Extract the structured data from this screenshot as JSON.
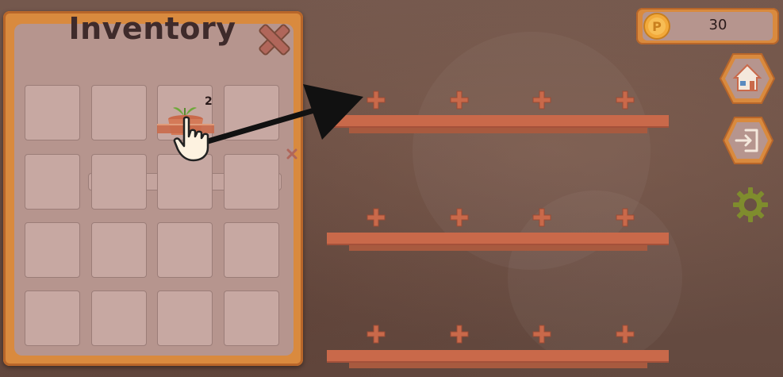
{
  "inventory": {
    "title": "Inventory",
    "item_count": "2"
  },
  "currency": {
    "value": "30",
    "symbol": "P"
  },
  "icons": {
    "close": "close-icon",
    "home": "home-icon",
    "exit": "exit-icon",
    "settings": "gear-icon",
    "hand": "hand-pointer-icon",
    "pot": "plant-pot-icon",
    "coin": "coin-icon"
  },
  "colors": {
    "panel_frame": "#d98a3e",
    "panel_fill": "#b6958e",
    "slot": "#c7a8a2",
    "shelf": "#c9694a",
    "plus": "#c9694a",
    "title_text": "#3f2b2b",
    "gear": "#7f8c2d"
  }
}
